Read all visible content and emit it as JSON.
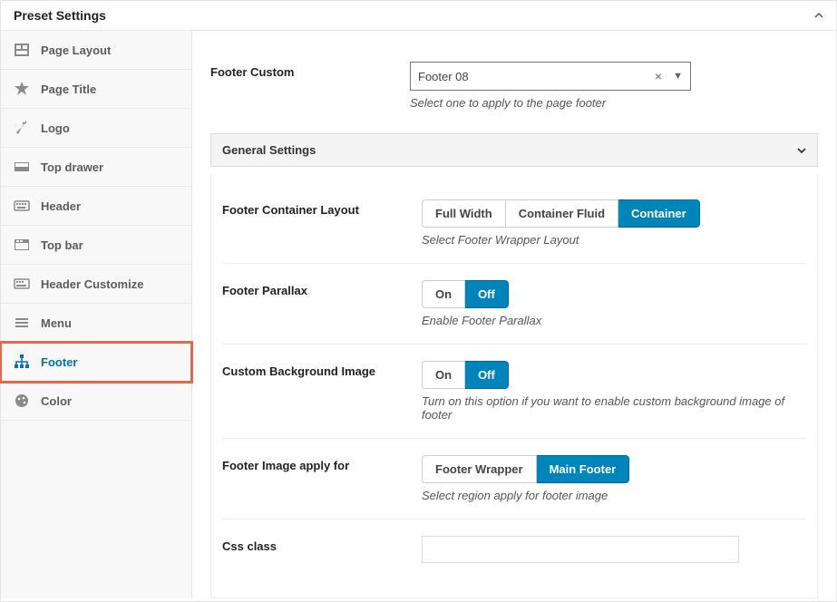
{
  "panel": {
    "title": "Preset Settings"
  },
  "sidebar": {
    "items": [
      {
        "label": "Page Layout",
        "icon": "layout-icon"
      },
      {
        "label": "Page Title",
        "icon": "star-icon"
      },
      {
        "label": "Logo",
        "icon": "carrot-icon"
      },
      {
        "label": "Top drawer",
        "icon": "drawer-icon"
      },
      {
        "label": "Header",
        "icon": "keyboard-icon"
      },
      {
        "label": "Top bar",
        "icon": "topbar-icon"
      },
      {
        "label": "Header Customize",
        "icon": "customize-icon"
      },
      {
        "label": "Menu",
        "icon": "menu-icon"
      },
      {
        "label": "Footer",
        "icon": "sitemap-icon"
      },
      {
        "label": "Color",
        "icon": "palette-icon"
      }
    ],
    "active_index": 8
  },
  "footer_custom": {
    "label": "Footer Custom",
    "value": "Footer 08",
    "help": "Select one to apply to the page footer"
  },
  "section": {
    "title": "General Settings"
  },
  "container_layout": {
    "label": "Footer Container Layout",
    "options": [
      "Full Width",
      "Container Fluid",
      "Container"
    ],
    "selected_index": 2,
    "help": "Select Footer Wrapper Layout"
  },
  "parallax": {
    "label": "Footer Parallax",
    "options": [
      "On",
      "Off"
    ],
    "selected_index": 1,
    "help": "Enable Footer Parallax"
  },
  "custom_bg": {
    "label": "Custom Background Image",
    "options": [
      "On",
      "Off"
    ],
    "selected_index": 1,
    "help": "Turn on this option if you want to enable custom background image of footer"
  },
  "image_apply": {
    "label": "Footer Image apply for",
    "options": [
      "Footer Wrapper",
      "Main Footer"
    ],
    "selected_index": 1,
    "help": "Select region apply for footer image"
  },
  "css_class": {
    "label": "Css class",
    "value": ""
  }
}
